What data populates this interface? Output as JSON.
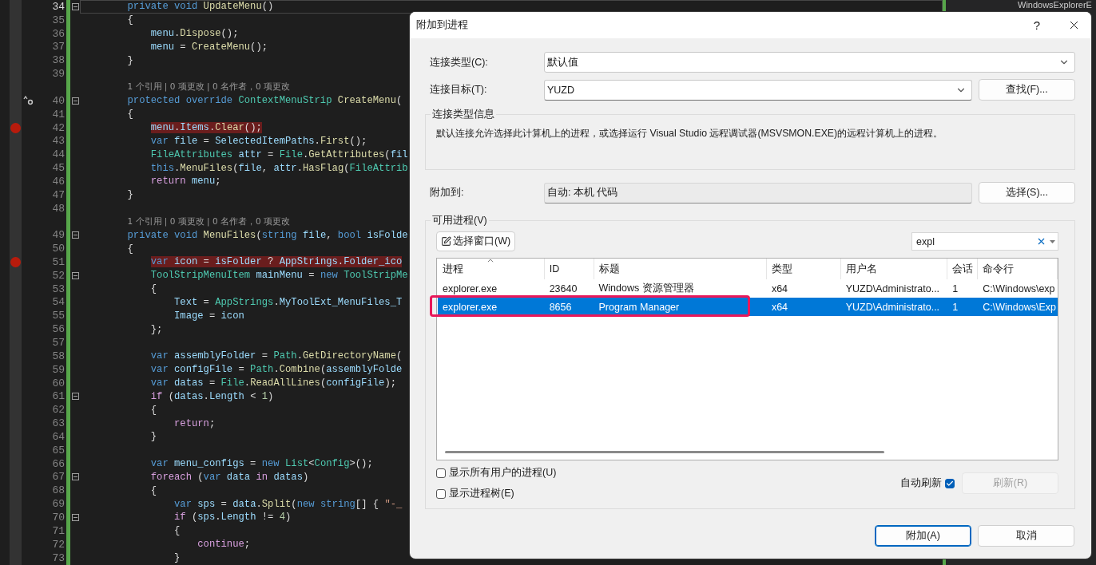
{
  "editor": {
    "lines": [
      {
        "kind": "code",
        "number": "34",
        "current": true,
        "foldable": true,
        "tokens": [
          {
            "kind": "keyword",
            "text": "        private void "
          },
          {
            "kind": "method",
            "text": "UpdateMenu"
          },
          {
            "kind": "plain",
            "text": "()"
          }
        ]
      },
      {
        "kind": "code",
        "number": "35",
        "tokens": [
          {
            "kind": "plain",
            "text": "        {"
          }
        ]
      },
      {
        "kind": "code",
        "number": "36",
        "tokens": [
          {
            "kind": "variable",
            "text": "            menu"
          },
          {
            "kind": "plain",
            "text": "."
          },
          {
            "kind": "method",
            "text": "Dispose"
          },
          {
            "kind": "plain",
            "text": "();"
          }
        ]
      },
      {
        "kind": "code",
        "number": "37",
        "tokens": [
          {
            "kind": "variable",
            "text": "            menu"
          },
          {
            "kind": "plain",
            "text": " = "
          },
          {
            "kind": "method",
            "text": "CreateMenu"
          },
          {
            "kind": "plain",
            "text": "();"
          }
        ]
      },
      {
        "kind": "code",
        "number": "38",
        "tokens": [
          {
            "kind": "plain",
            "text": "        }"
          }
        ]
      },
      {
        "kind": "blank",
        "number": "39"
      },
      {
        "kind": "lens",
        "text": "        1 个引用 | 0 项更改 | 0 名作者，0 项更改"
      },
      {
        "kind": "code",
        "number": "40",
        "override_marker": true,
        "foldable": true,
        "tokens": [
          {
            "kind": "keyword",
            "text": "        protected override "
          },
          {
            "kind": "type",
            "text": "ContextMenuStrip "
          },
          {
            "kind": "method",
            "text": "CreateMenu"
          },
          {
            "kind": "plain",
            "text": "("
          }
        ]
      },
      {
        "kind": "code",
        "number": "41",
        "tokens": [
          {
            "kind": "plain",
            "text": "        {"
          }
        ]
      },
      {
        "kind": "code",
        "number": "42",
        "breakpoint": true,
        "tokens": [
          {
            "kind": "variable",
            "text": "            menu"
          },
          {
            "kind": "plain",
            "text": "."
          },
          {
            "kind": "variable",
            "text": "Items"
          },
          {
            "kind": "plain",
            "text": "."
          },
          {
            "kind": "method",
            "text": "Clear"
          },
          {
            "kind": "plain",
            "text": "();"
          }
        ]
      },
      {
        "kind": "code",
        "number": "43",
        "tokens": [
          {
            "kind": "keyword",
            "text": "            var "
          },
          {
            "kind": "variable",
            "text": "file"
          },
          {
            "kind": "plain",
            "text": " = "
          },
          {
            "kind": "variable",
            "text": "SelectedItemPaths"
          },
          {
            "kind": "plain",
            "text": "."
          },
          {
            "kind": "method",
            "text": "First"
          },
          {
            "kind": "plain",
            "text": "();"
          }
        ]
      },
      {
        "kind": "code",
        "number": "44",
        "tokens": [
          {
            "kind": "type",
            "text": "            FileAttributes "
          },
          {
            "kind": "variable",
            "text": "attr"
          },
          {
            "kind": "plain",
            "text": " = "
          },
          {
            "kind": "type",
            "text": "File"
          },
          {
            "kind": "plain",
            "text": "."
          },
          {
            "kind": "method",
            "text": "GetAttributes"
          },
          {
            "kind": "plain",
            "text": "("
          },
          {
            "kind": "variable",
            "text": "fil"
          }
        ]
      },
      {
        "kind": "code",
        "number": "45",
        "tokens": [
          {
            "kind": "keyword",
            "text": "            this"
          },
          {
            "kind": "plain",
            "text": "."
          },
          {
            "kind": "method",
            "text": "MenuFiles"
          },
          {
            "kind": "plain",
            "text": "("
          },
          {
            "kind": "variable",
            "text": "file"
          },
          {
            "kind": "plain",
            "text": ", "
          },
          {
            "kind": "variable",
            "text": "attr"
          },
          {
            "kind": "plain",
            "text": "."
          },
          {
            "kind": "method",
            "text": "HasFlag"
          },
          {
            "kind": "plain",
            "text": "("
          },
          {
            "kind": "type",
            "text": "FileAttrib"
          }
        ]
      },
      {
        "kind": "code",
        "number": "46",
        "tokens": [
          {
            "kind": "control",
            "text": "            return "
          },
          {
            "kind": "variable",
            "text": "menu"
          },
          {
            "kind": "plain",
            "text": ";"
          }
        ]
      },
      {
        "kind": "code",
        "number": "47",
        "tokens": [
          {
            "kind": "plain",
            "text": "        }"
          }
        ]
      },
      {
        "kind": "blank",
        "number": "48"
      },
      {
        "kind": "lens",
        "text": "        1 个引用 | 0 项更改 | 0 名作者，0 项更改"
      },
      {
        "kind": "code",
        "number": "49",
        "foldable": true,
        "tokens": [
          {
            "kind": "keyword",
            "text": "        private void "
          },
          {
            "kind": "method",
            "text": "MenuFiles"
          },
          {
            "kind": "plain",
            "text": "("
          },
          {
            "kind": "keyword",
            "text": "string "
          },
          {
            "kind": "variable",
            "text": "file"
          },
          {
            "kind": "plain",
            "text": ", "
          },
          {
            "kind": "keyword",
            "text": "bool "
          },
          {
            "kind": "variable",
            "text": "isFolde"
          }
        ]
      },
      {
        "kind": "code",
        "number": "50",
        "tokens": [
          {
            "kind": "plain",
            "text": "        {"
          }
        ]
      },
      {
        "kind": "code",
        "number": "51",
        "breakpoint": true,
        "tokens": [
          {
            "kind": "keyword",
            "text": "            var "
          },
          {
            "kind": "variable",
            "text": "icon"
          },
          {
            "kind": "plain",
            "text": " = "
          },
          {
            "kind": "variable",
            "text": "isFolder"
          },
          {
            "kind": "plain",
            "text": " ? "
          },
          {
            "kind": "variable",
            "text": "AppStrings"
          },
          {
            "kind": "plain",
            "text": "."
          },
          {
            "kind": "variable",
            "text": "Folder_ico"
          }
        ]
      },
      {
        "kind": "code",
        "number": "52",
        "foldable": true,
        "tokens": [
          {
            "kind": "type",
            "text": "            ToolStripMenuItem "
          },
          {
            "kind": "variable",
            "text": "mainMenu"
          },
          {
            "kind": "plain",
            "text": " = "
          },
          {
            "kind": "keyword",
            "text": "new "
          },
          {
            "kind": "type",
            "text": "ToolStripMe"
          }
        ]
      },
      {
        "kind": "code",
        "number": "53",
        "tokens": [
          {
            "kind": "plain",
            "text": "            {"
          }
        ]
      },
      {
        "kind": "code",
        "number": "54",
        "tokens": [
          {
            "kind": "variable",
            "text": "                Text"
          },
          {
            "kind": "plain",
            "text": " = "
          },
          {
            "kind": "type",
            "text": "AppStrings"
          },
          {
            "kind": "plain",
            "text": "."
          },
          {
            "kind": "variable",
            "text": "MyToolExt_MenuFiles_T"
          }
        ]
      },
      {
        "kind": "code",
        "number": "55",
        "tokens": [
          {
            "kind": "variable",
            "text": "                Image"
          },
          {
            "kind": "plain",
            "text": " = "
          },
          {
            "kind": "variable",
            "text": "icon"
          }
        ]
      },
      {
        "kind": "code",
        "number": "56",
        "tokens": [
          {
            "kind": "plain",
            "text": "            };"
          }
        ]
      },
      {
        "kind": "blank",
        "number": "57"
      },
      {
        "kind": "code",
        "number": "58",
        "tokens": [
          {
            "kind": "keyword",
            "text": "            var "
          },
          {
            "kind": "variable",
            "text": "assemblyFolder"
          },
          {
            "kind": "plain",
            "text": " = "
          },
          {
            "kind": "type",
            "text": "Path"
          },
          {
            "kind": "plain",
            "text": "."
          },
          {
            "kind": "method",
            "text": "GetDirectoryName"
          },
          {
            "kind": "plain",
            "text": "("
          }
        ]
      },
      {
        "kind": "code",
        "number": "59",
        "tokens": [
          {
            "kind": "keyword",
            "text": "            var "
          },
          {
            "kind": "variable",
            "text": "configFile"
          },
          {
            "kind": "plain",
            "text": " = "
          },
          {
            "kind": "type",
            "text": "Path"
          },
          {
            "kind": "plain",
            "text": "."
          },
          {
            "kind": "method",
            "text": "Combine"
          },
          {
            "kind": "plain",
            "text": "("
          },
          {
            "kind": "variable",
            "text": "assemblyFolde"
          }
        ]
      },
      {
        "kind": "code",
        "number": "60",
        "tokens": [
          {
            "kind": "keyword",
            "text": "            var "
          },
          {
            "kind": "variable",
            "text": "datas"
          },
          {
            "kind": "plain",
            "text": " = "
          },
          {
            "kind": "type",
            "text": "File"
          },
          {
            "kind": "plain",
            "text": "."
          },
          {
            "kind": "method",
            "text": "ReadAllLines"
          },
          {
            "kind": "plain",
            "text": "("
          },
          {
            "kind": "variable",
            "text": "configFile"
          },
          {
            "kind": "plain",
            "text": ");"
          }
        ]
      },
      {
        "kind": "code",
        "number": "61",
        "foldable": true,
        "tokens": [
          {
            "kind": "control",
            "text": "            if "
          },
          {
            "kind": "plain",
            "text": "("
          },
          {
            "kind": "variable",
            "text": "datas"
          },
          {
            "kind": "plain",
            "text": "."
          },
          {
            "kind": "variable",
            "text": "Length"
          },
          {
            "kind": "plain",
            "text": " < "
          },
          {
            "kind": "number",
            "text": "1"
          },
          {
            "kind": "plain",
            "text": ")"
          }
        ]
      },
      {
        "kind": "code",
        "number": "62",
        "tokens": [
          {
            "kind": "plain",
            "text": "            {"
          }
        ]
      },
      {
        "kind": "code",
        "number": "63",
        "tokens": [
          {
            "kind": "control",
            "text": "                return"
          },
          {
            "kind": "plain",
            "text": ";"
          }
        ]
      },
      {
        "kind": "code",
        "number": "64",
        "tokens": [
          {
            "kind": "plain",
            "text": "            }"
          }
        ]
      },
      {
        "kind": "blank",
        "number": "65"
      },
      {
        "kind": "code",
        "number": "66",
        "tokens": [
          {
            "kind": "keyword",
            "text": "            var "
          },
          {
            "kind": "variable",
            "text": "menu_configs"
          },
          {
            "kind": "plain",
            "text": " = "
          },
          {
            "kind": "keyword",
            "text": "new "
          },
          {
            "kind": "type",
            "text": "List"
          },
          {
            "kind": "plain",
            "text": "<"
          },
          {
            "kind": "type",
            "text": "Config"
          },
          {
            "kind": "plain",
            "text": ">();"
          }
        ]
      },
      {
        "kind": "code",
        "number": "67",
        "foldable": true,
        "tokens": [
          {
            "kind": "control",
            "text": "            foreach "
          },
          {
            "kind": "plain",
            "text": "("
          },
          {
            "kind": "keyword",
            "text": "var "
          },
          {
            "kind": "variable",
            "text": "data "
          },
          {
            "kind": "control",
            "text": "in "
          },
          {
            "kind": "variable",
            "text": "datas"
          },
          {
            "kind": "plain",
            "text": ")"
          }
        ]
      },
      {
        "kind": "code",
        "number": "68",
        "tokens": [
          {
            "kind": "plain",
            "text": "            {"
          }
        ]
      },
      {
        "kind": "code",
        "number": "69",
        "tokens": [
          {
            "kind": "keyword",
            "text": "                var "
          },
          {
            "kind": "variable",
            "text": "sps"
          },
          {
            "kind": "plain",
            "text": " = "
          },
          {
            "kind": "variable",
            "text": "data"
          },
          {
            "kind": "plain",
            "text": "."
          },
          {
            "kind": "method",
            "text": "Split"
          },
          {
            "kind": "plain",
            "text": "("
          },
          {
            "kind": "keyword",
            "text": "new string"
          },
          {
            "kind": "plain",
            "text": "[] { "
          },
          {
            "kind": "string",
            "text": "\"-_"
          }
        ]
      },
      {
        "kind": "code",
        "number": "70",
        "foldable": true,
        "tokens": [
          {
            "kind": "control",
            "text": "                if "
          },
          {
            "kind": "plain",
            "text": "("
          },
          {
            "kind": "variable",
            "text": "sps"
          },
          {
            "kind": "plain",
            "text": "."
          },
          {
            "kind": "variable",
            "text": "Length"
          },
          {
            "kind": "plain",
            "text": " != "
          },
          {
            "kind": "number",
            "text": "4"
          },
          {
            "kind": "plain",
            "text": ")"
          }
        ]
      },
      {
        "kind": "code",
        "number": "71",
        "tokens": [
          {
            "kind": "plain",
            "text": "                {"
          }
        ]
      },
      {
        "kind": "code",
        "number": "72",
        "tokens": [
          {
            "kind": "control",
            "text": "                    continue"
          },
          {
            "kind": "plain",
            "text": ";"
          }
        ]
      },
      {
        "kind": "code",
        "number": "73",
        "tokens": [
          {
            "kind": "plain",
            "text": "                }"
          }
        ]
      }
    ]
  },
  "side_panel": {
    "title": "WindowsExplorerE"
  },
  "dialog": {
    "title": "附加到进程",
    "help": "?",
    "connection_type": {
      "label": "连接类型(C):",
      "value": "默认值"
    },
    "connection_target": {
      "label": "连接目标(T):",
      "value": "YUZD",
      "button": "查找(F)..."
    },
    "info": {
      "title": "连接类型信息",
      "text": "默认连接允许选择此计算机上的进程，或选择运行 Visual Studio 远程调试器(MSVSMON.EXE)的远程计算机上的进程。"
    },
    "attach_to": {
      "label": "附加到:",
      "value": "自动: 本机 代码",
      "button": "选择(S)..."
    },
    "processes": {
      "title": "可用进程(V)",
      "select_window": "选择窗口(W)",
      "filter": {
        "value": "expl"
      },
      "columns": [
        {
          "label": "进程",
          "sorted": true
        },
        {
          "label": "ID",
          "sorted": false
        },
        {
          "label": "标题",
          "sorted": false
        },
        {
          "label": "类型",
          "sorted": false
        },
        {
          "label": "用户名",
          "sorted": false
        },
        {
          "label": "会话",
          "sorted": false
        },
        {
          "label": "命令行",
          "sorted": false
        }
      ],
      "rows": [
        {
          "selected": false,
          "annotated": false,
          "cells": [
            "explorer.exe",
            "23640",
            "Windows 资源管理器",
            "x64",
            "YUZD\\Administrato...",
            "1",
            "C:\\Windows\\exp"
          ]
        },
        {
          "selected": true,
          "annotated": true,
          "cells": [
            "explorer.exe",
            "8656",
            "Program Manager",
            "x64",
            "YUZD\\Administrato...",
            "1",
            "C:\\Windows\\Exp"
          ]
        }
      ],
      "options": [
        {
          "label": "显示所有用户的进程(U)",
          "checked": false
        },
        {
          "label": "显示进程树(E)",
          "checked": false
        }
      ],
      "auto_refresh": {
        "label": "自动刷新",
        "checked": true
      },
      "refresh": {
        "label": "刷新(R)",
        "disabled": true
      }
    },
    "buttons": [
      {
        "label": "附加(A)",
        "primary": true
      },
      {
        "label": "取消",
        "primary": false
      }
    ]
  }
}
